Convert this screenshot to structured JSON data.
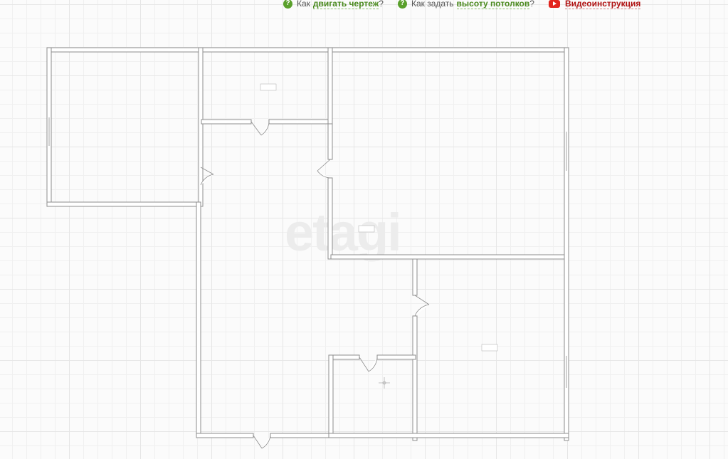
{
  "toolbar": {
    "link1": {
      "icon": "question-icon",
      "prefix": "Как",
      "highlight": "двигать чертеж",
      "suffix": "?"
    },
    "link2": {
      "icon": "question-icon",
      "prefix": "Как задать",
      "highlight": "высоту потолков",
      "suffix": "?"
    },
    "video": {
      "icon": "youtube-play-icon",
      "label": "Видеоинструкция"
    }
  },
  "watermark": "etagi",
  "colors": {
    "help_green": "#5aa02c",
    "video_red": "#e2241d",
    "wall": "#8c8c8c"
  }
}
